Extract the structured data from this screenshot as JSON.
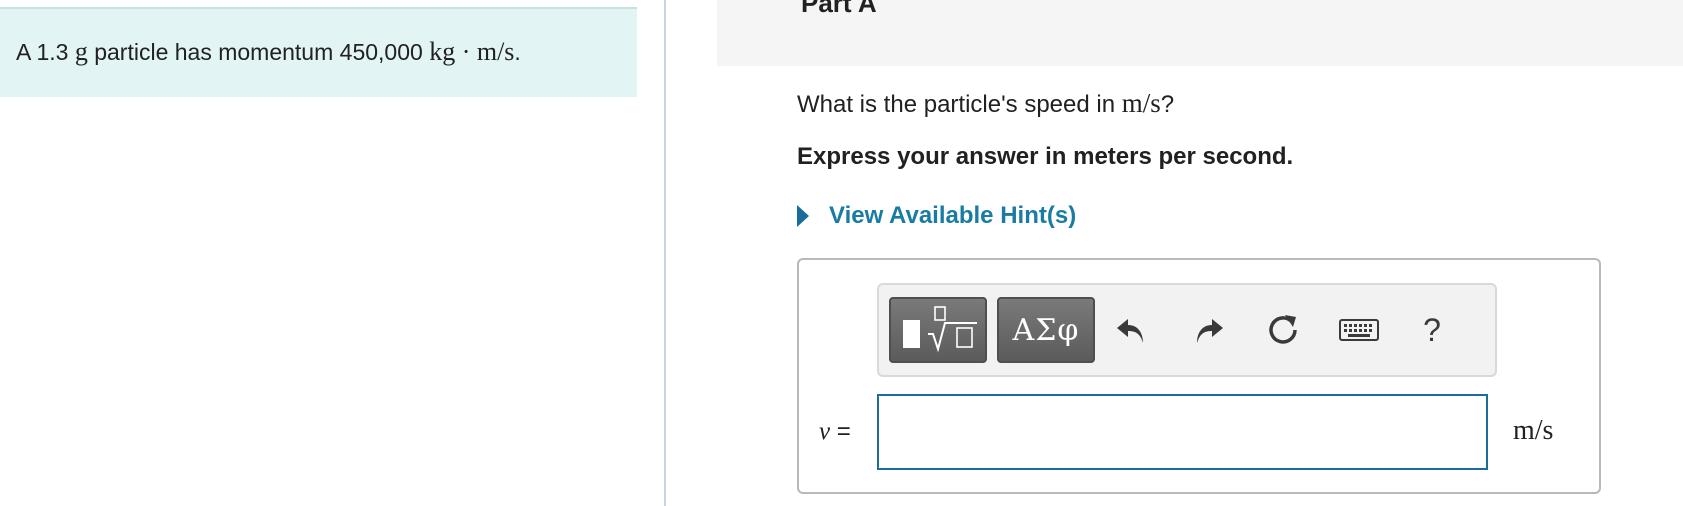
{
  "problem": {
    "prefix": "A 1.3 ",
    "mass_unit": "g",
    "middle": " particle has momentum 450,000 ",
    "momentum_unit": "kg · m/s",
    "suffix": "."
  },
  "part": {
    "title": "Part A"
  },
  "question": {
    "prefix": "What is the particle's speed in ",
    "unit": "m/s",
    "suffix": "?"
  },
  "instruction": "Express your answer in meters per second.",
  "hint": {
    "label": "View Available Hint(s)"
  },
  "toolbar": {
    "templates_icon": "templates-sqrt-icon",
    "greek_label": "ΑΣφ",
    "undo_icon": "undo-icon",
    "redo_icon": "redo-icon",
    "reset_icon": "reset-icon",
    "keyboard_icon": "keyboard-icon",
    "help_label": "?"
  },
  "answer": {
    "variable": "v",
    "equals": " =",
    "value": "",
    "unit": "m/s"
  },
  "colors": {
    "problem_bg": "#e3f4f5",
    "link": "#1a7ca3",
    "input_border": "#1a6d97",
    "toolbar_button": "#666666"
  }
}
